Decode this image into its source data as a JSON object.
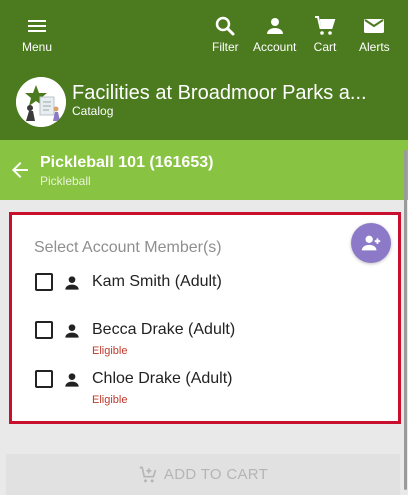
{
  "nav": {
    "menu": "Menu",
    "filter": "Filter",
    "account": "Account",
    "cart": "Cart",
    "alerts": "Alerts"
  },
  "facility": {
    "title": "Facilities at Broadmoor Parks a...",
    "subtitle": "Catalog"
  },
  "program": {
    "title": "Pickleball 101 (161653)",
    "subtitle": "Pickleball"
  },
  "members_card": {
    "label": "Select Account Member(s)",
    "members": [
      {
        "name": "Kam Smith (Adult)",
        "status": "",
        "checked": false
      },
      {
        "name": "Becca Drake (Adult)",
        "status": "Eligible",
        "checked": false
      },
      {
        "name": "Chloe Drake (Adult)",
        "status": "Eligible",
        "checked": false
      }
    ]
  },
  "actions": {
    "add_to_cart": "ADD TO CART"
  },
  "colors": {
    "header_dark": "#4b7a1f",
    "header_light": "#88c341",
    "card_border": "#c8102e",
    "fab": "#8c7ac8",
    "eligible_text": "#c0392b"
  },
  "icons": [
    "menu-icon",
    "search-icon",
    "person-icon",
    "cart-icon",
    "mail-icon",
    "arrow-back-icon",
    "add-person-icon",
    "add-shopping-cart-icon"
  ]
}
